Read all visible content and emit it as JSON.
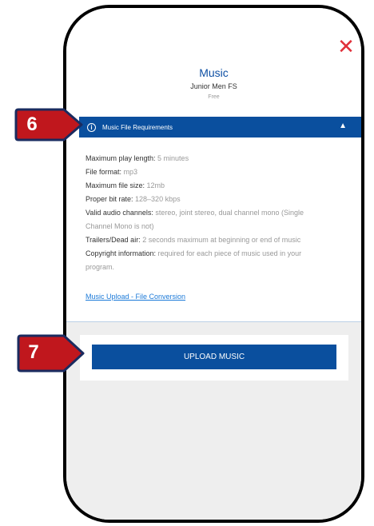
{
  "modal": {
    "title": "Music",
    "subtitle": "Junior Men FS",
    "tier": "Free",
    "close_icon": "close-x-icon",
    "close_symbol": "✕"
  },
  "requirements": {
    "label": "Music File Requirements",
    "info_icon": "info-icon",
    "info_symbol": "i",
    "chevron_icon": "chevron-up-icon",
    "chevron_symbol": "▲",
    "items": [
      {
        "key": "Maximum play length:",
        "value": " 5 minutes"
      },
      {
        "key": "File format:",
        "value": " mp3"
      },
      {
        "key": "Maximum file size:",
        "value": " 12mb"
      },
      {
        "key": "Proper bit rate:",
        "value": " 128–320 kbps"
      },
      {
        "key": "Valid audio channels:",
        "value": " stereo, joint stereo, dual channel mono (Single"
      },
      {
        "key": "",
        "value": "Channel Mono is not)"
      },
      {
        "key": "Trailers/Dead air:",
        "value": " 2 seconds maximum at beginning or end of music"
      },
      {
        "key": "Copyright information:",
        "value": " required for each piece of music used in your"
      },
      {
        "key": "",
        "value": "program."
      }
    ],
    "link": "Music Upload - File Conversion"
  },
  "upload": {
    "label": "UPLOAD MUSIC"
  },
  "callouts": [
    {
      "number": "6"
    },
    {
      "number": "7"
    }
  ],
  "colors": {
    "brand_blue": "#0a4f9e",
    "close_red": "#e0303a",
    "callout_red": "#c0171d",
    "callout_border": "#1a2b5f",
    "link_blue": "#1c7ad8"
  }
}
